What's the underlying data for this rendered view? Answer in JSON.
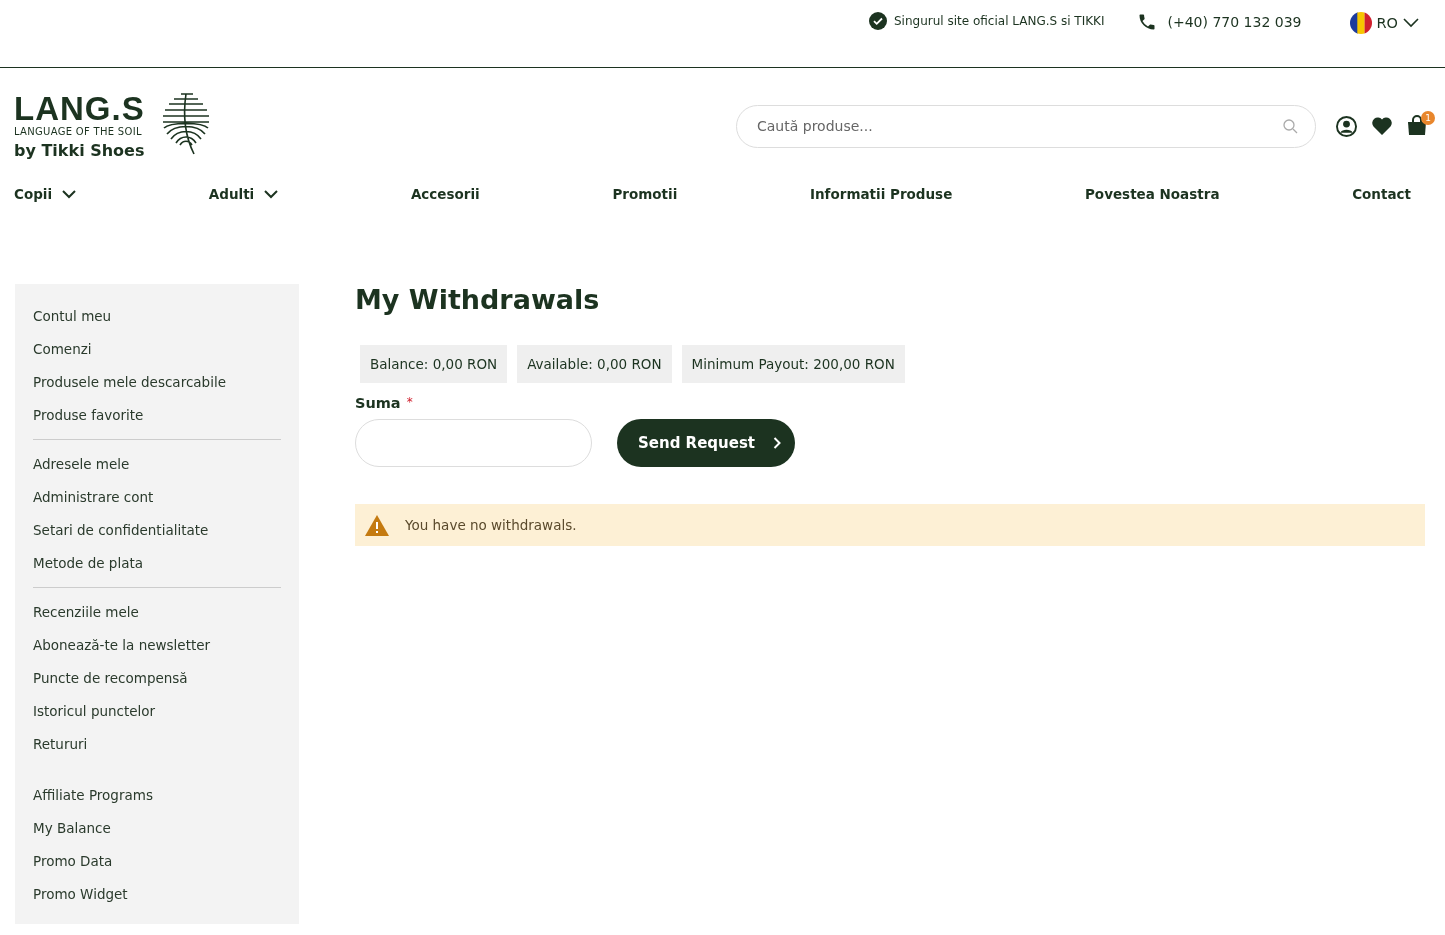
{
  "topbar": {
    "official": "Singurul site oficial LANG.S si TIKKI",
    "phone": "(+40) 770 132 039",
    "language": "RO"
  },
  "logo": {
    "name": "LANG.S",
    "tagline": "LANGUAGE OF THE SOIL",
    "by": "by Tikki Shoes"
  },
  "search": {
    "placeholder": "Caută produse..."
  },
  "cart": {
    "count": "1"
  },
  "nav": [
    {
      "label": "Copii",
      "dropdown": true
    },
    {
      "label": "Adulti",
      "dropdown": true
    },
    {
      "label": "Accesorii",
      "dropdown": false
    },
    {
      "label": "Promotii",
      "dropdown": false
    },
    {
      "label": "Informatii Produse",
      "dropdown": false
    },
    {
      "label": "Povestea Noastra",
      "dropdown": false
    },
    {
      "label": "Contact",
      "dropdown": false
    }
  ],
  "sidebar": {
    "groups": [
      {
        "divider_after": true,
        "items": [
          "Contul meu",
          "Comenzi",
          "Produsele mele descarcabile",
          "Produse favorite"
        ]
      },
      {
        "divider_after": true,
        "items": [
          "Adresele mele",
          "Administrare cont",
          "Setari de confidentialitate",
          "Metode de plata"
        ]
      },
      {
        "divider_after": false,
        "items": [
          "Recenziile mele",
          "Abonează-te la newsletter",
          "Puncte de recompensă",
          "Istoricul punctelor",
          "Retururi"
        ]
      },
      {
        "divider_after": false,
        "items": [
          "Affiliate Programs",
          "My Balance",
          "Promo Data",
          "Promo Widget"
        ]
      }
    ]
  },
  "main": {
    "title": "My Withdrawals",
    "stats": [
      "Balance: 0,00 RON",
      "Available: 0,00 RON",
      "Minimum Payout: 200,00 RON"
    ],
    "field": {
      "label": "Suma",
      "required_mark": "*"
    },
    "button": "Send Request",
    "notice": "You have no withdrawals."
  }
}
